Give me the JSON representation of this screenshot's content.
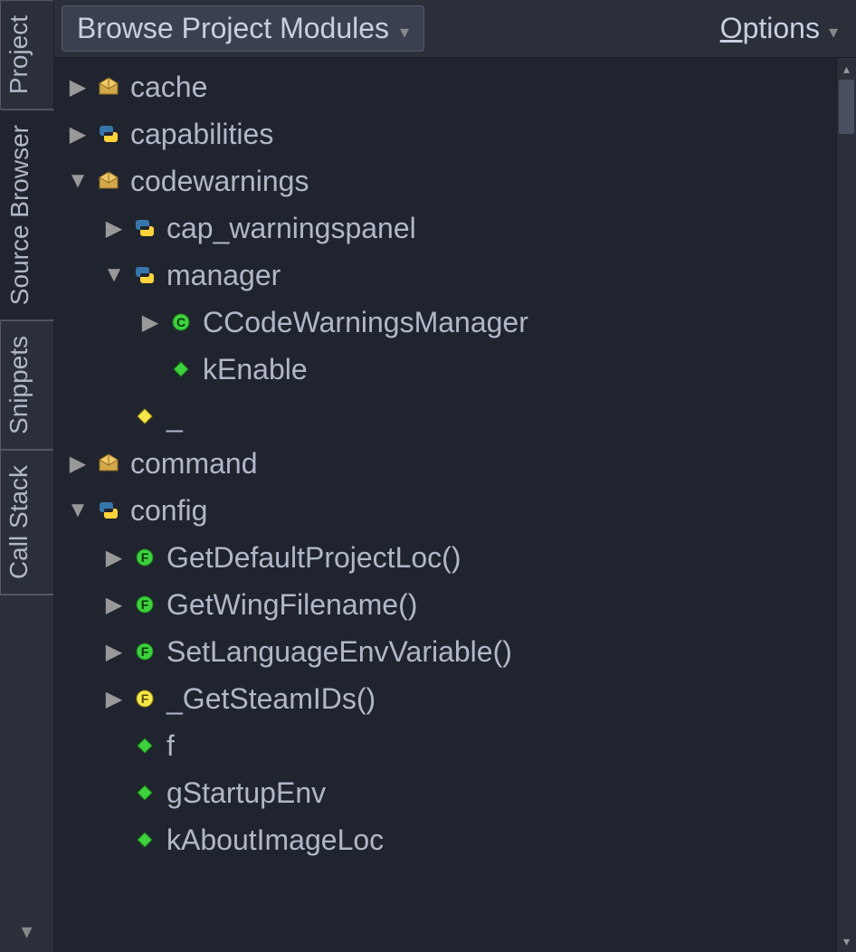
{
  "tabs": {
    "project": "Project",
    "sourceBrowser": "Source Browser",
    "snippets": "Snippets",
    "callStack": "Call Stack"
  },
  "toolbar": {
    "browseLabel": "Browse Project Modules",
    "optionsLabel_pre": "O",
    "optionsLabel_rest": "ptions"
  },
  "tree": [
    {
      "level": 0,
      "disclosure": "closed",
      "icon": "package",
      "label": "cache"
    },
    {
      "level": 0,
      "disclosure": "closed",
      "icon": "python",
      "label": "capabilities"
    },
    {
      "level": 0,
      "disclosure": "open",
      "icon": "package",
      "label": "codewarnings"
    },
    {
      "level": 1,
      "disclosure": "closed",
      "icon": "python",
      "label": "cap_warningspanel"
    },
    {
      "level": 1,
      "disclosure": "open",
      "icon": "python",
      "label": "manager"
    },
    {
      "level": 2,
      "disclosure": "closed",
      "icon": "class",
      "label": "CCodeWarningsManager"
    },
    {
      "level": 2,
      "disclosure": "none",
      "icon": "var-green",
      "label": "kEnable"
    },
    {
      "level": 1,
      "disclosure": "none",
      "icon": "var-yellow",
      "label": "_"
    },
    {
      "level": 0,
      "disclosure": "closed",
      "icon": "package",
      "label": "command"
    },
    {
      "level": 0,
      "disclosure": "open",
      "icon": "python",
      "label": "config"
    },
    {
      "level": 1,
      "disclosure": "closed",
      "icon": "func-green",
      "label": "GetDefaultProjectLoc()"
    },
    {
      "level": 1,
      "disclosure": "closed",
      "icon": "func-green",
      "label": "GetWingFilename()"
    },
    {
      "level": 1,
      "disclosure": "closed",
      "icon": "func-green",
      "label": "SetLanguageEnvVariable()"
    },
    {
      "level": 1,
      "disclosure": "closed",
      "icon": "func-yellow",
      "label": "_GetSteamIDs()"
    },
    {
      "level": 1,
      "disclosure": "none",
      "icon": "var-green",
      "label": "f"
    },
    {
      "level": 1,
      "disclosure": "none",
      "icon": "var-green",
      "label": "gStartupEnv"
    },
    {
      "level": 1,
      "disclosure": "none",
      "icon": "var-green",
      "label": "kAboutImageLoc"
    }
  ]
}
